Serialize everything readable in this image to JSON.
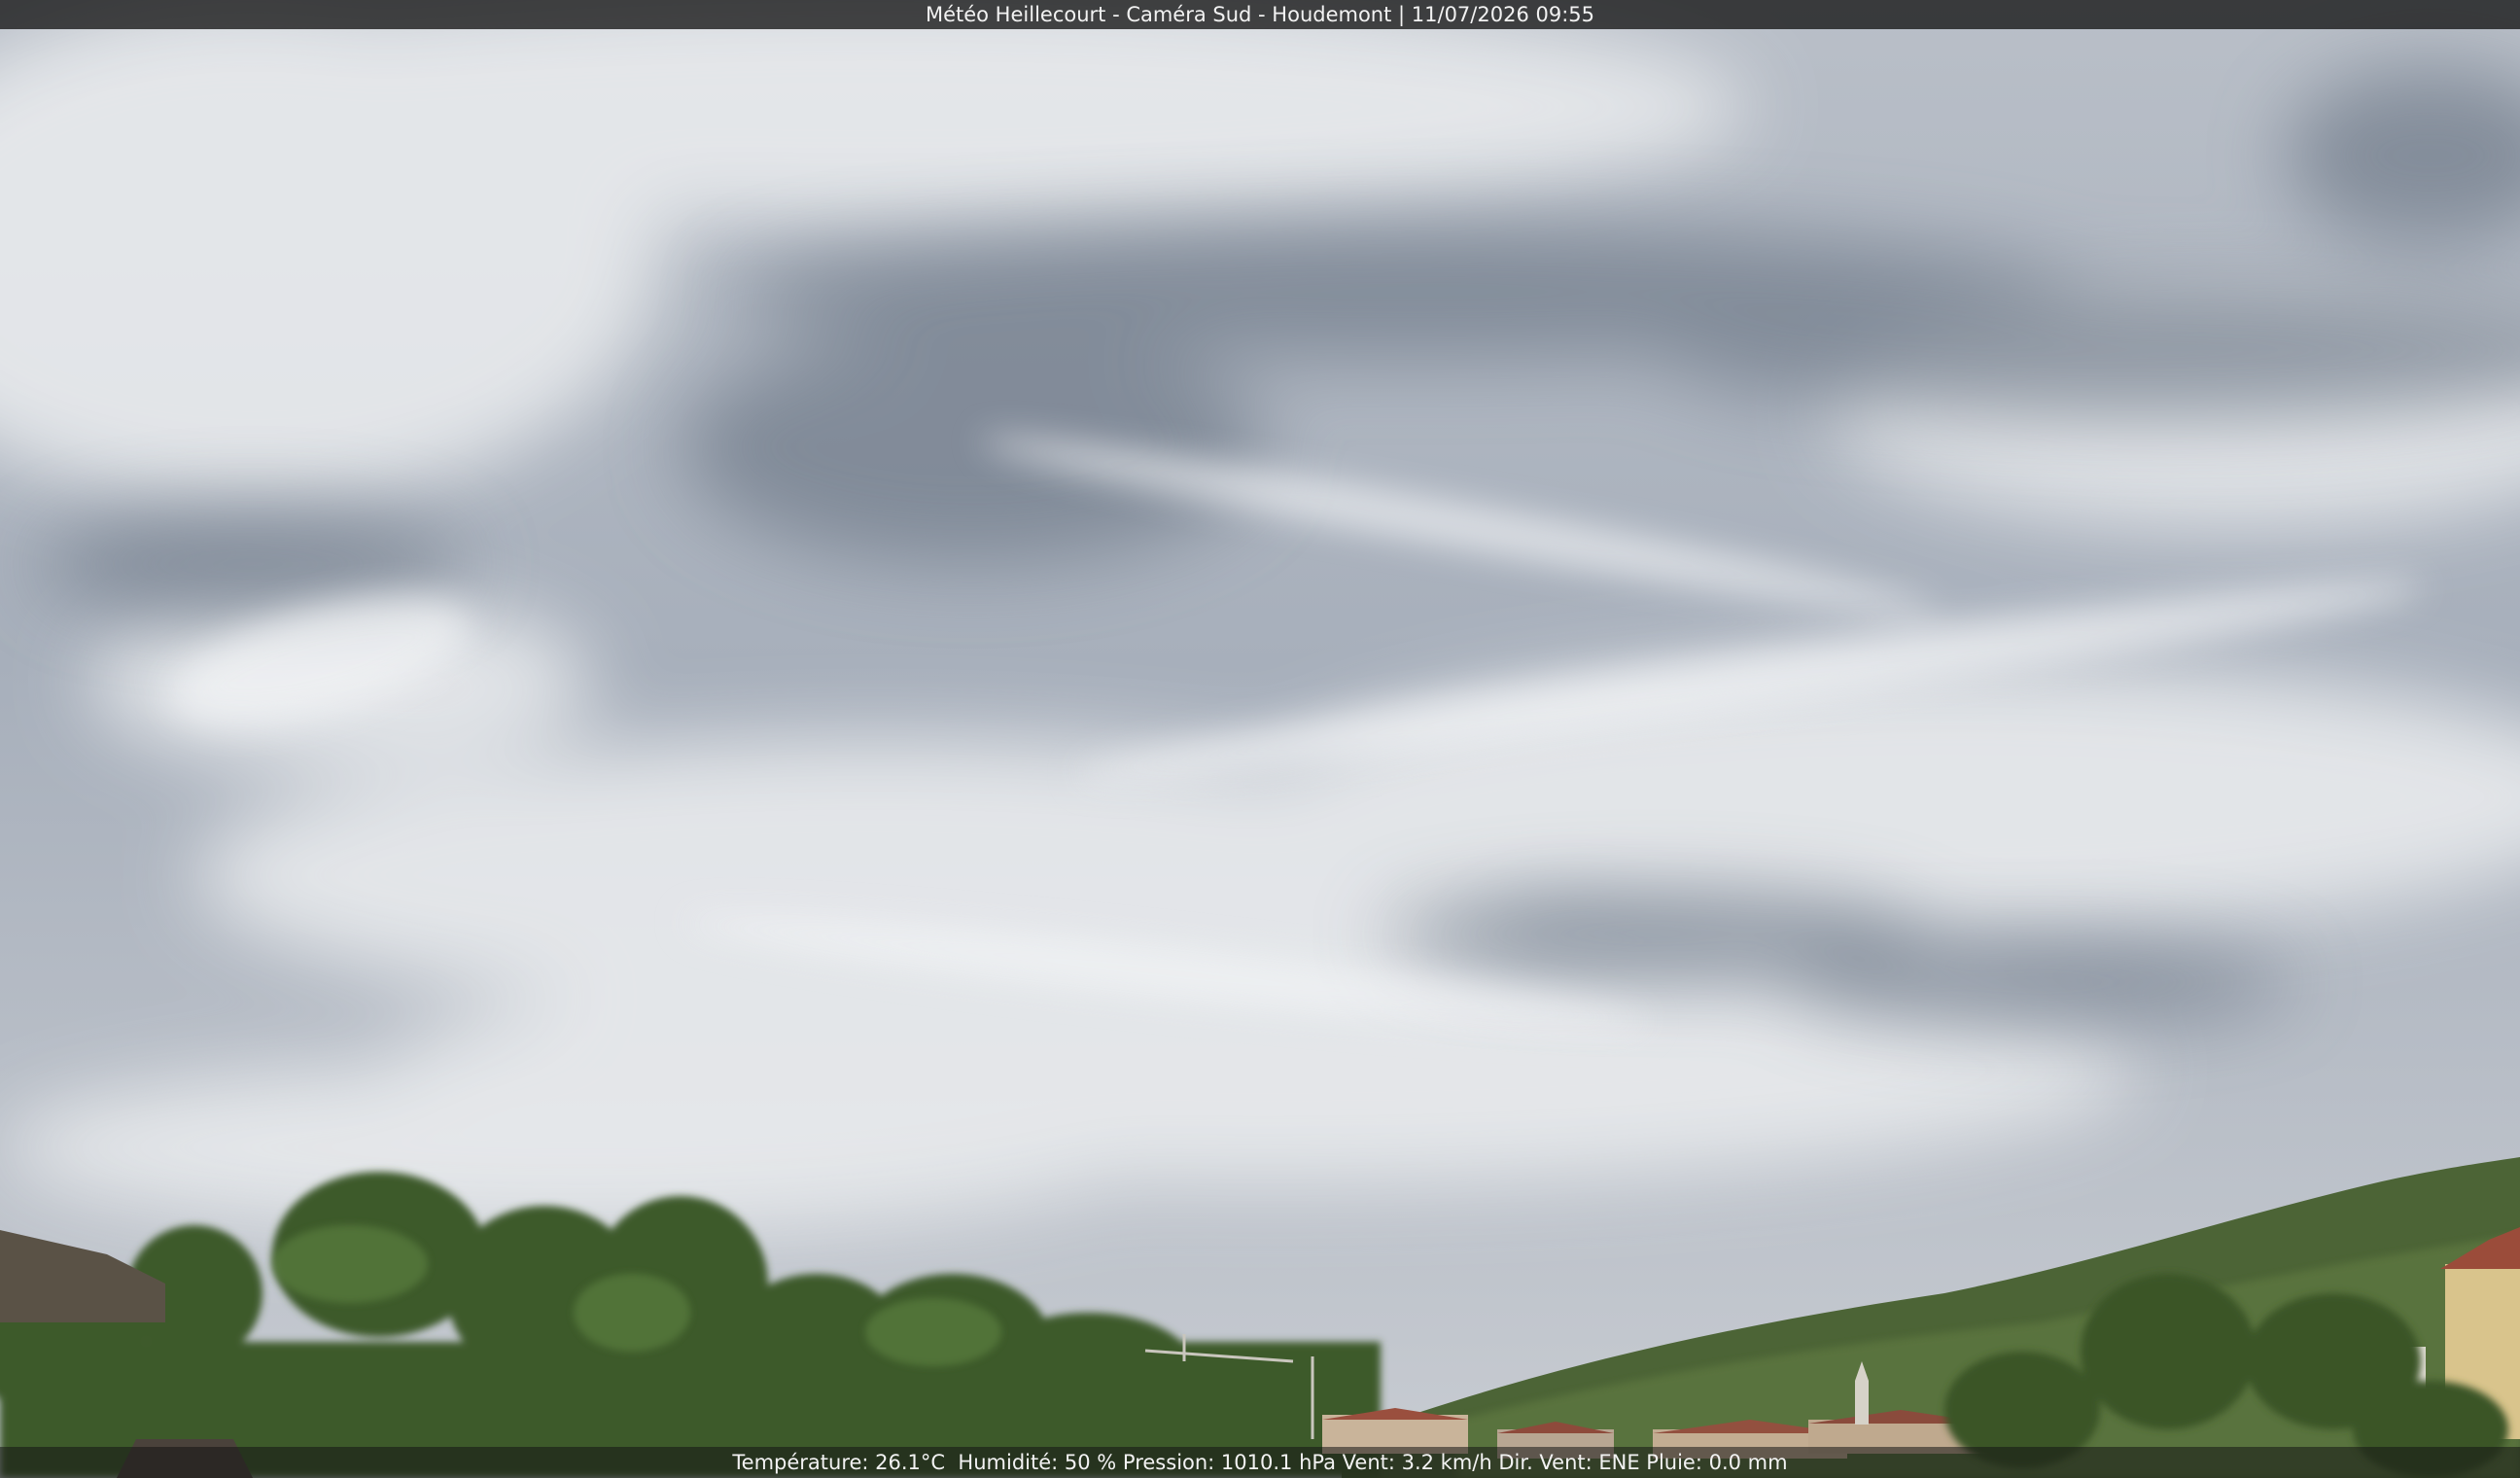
{
  "overlay": {
    "title": "Météo Heillecourt - Caméra Sud - Houdemont | 11/07/2026 09:55",
    "weather": "Température: 26.1°C  Humidité: 50 % Pression: 1010.1 hPa Vent: 3.2 km/h Dir. Vent: ENE Pluie: 0.0 mm"
  },
  "scene": {
    "sky_color": "#a4acb8",
    "cloud_color": "#e6e8eb",
    "dark_cloud_color": "#6f7988",
    "tree_color": "#3f5a2c",
    "roof_color": "#8a4b3c"
  }
}
